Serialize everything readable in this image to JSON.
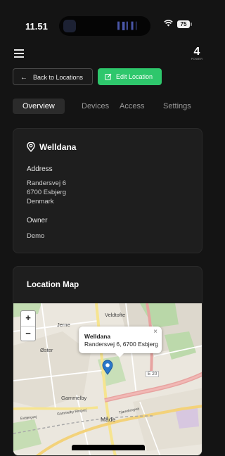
{
  "status_bar": {
    "time": "11.51",
    "battery": "75"
  },
  "brand": {
    "logo_main": "4",
    "logo_sub": "POWER"
  },
  "actions": {
    "back_label": "Back to Locations",
    "edit_label": "Edit Location"
  },
  "tabs": [
    {
      "label": "Overview",
      "active": true
    },
    {
      "label": "Devices",
      "active": false
    },
    {
      "label": "Access",
      "active": false
    },
    {
      "label": "Settings",
      "active": false
    }
  ],
  "location": {
    "name": "Welldana",
    "address_label": "Address",
    "address_lines": [
      "Randersvej 6",
      "6700 Esbjerg",
      "Denmark"
    ],
    "owner_label": "Owner",
    "owner_value": "Demo"
  },
  "map_card": {
    "title": "Location Map",
    "zoom_in": "+",
    "zoom_out": "−",
    "popup_title": "Welldana",
    "popup_address": "Randersvej 6, 6700 Esbjerg",
    "popup_close": "×",
    "labels": {
      "veldtofte": "Veldtofte",
      "jerne": "Jerne",
      "oster": "Øster",
      "gammelby": "Gammelby",
      "made": "Måde",
      "e20": "E 20",
      "ring": "Gammelby Ringvej",
      "tjaere": "Tjæreborgvej",
      "esbvej": "Esbjergvej"
    }
  },
  "colors": {
    "accent": "#2ec76c",
    "background": "#141414",
    "card": "#1e1e1e",
    "pin": "#2a77c9"
  }
}
